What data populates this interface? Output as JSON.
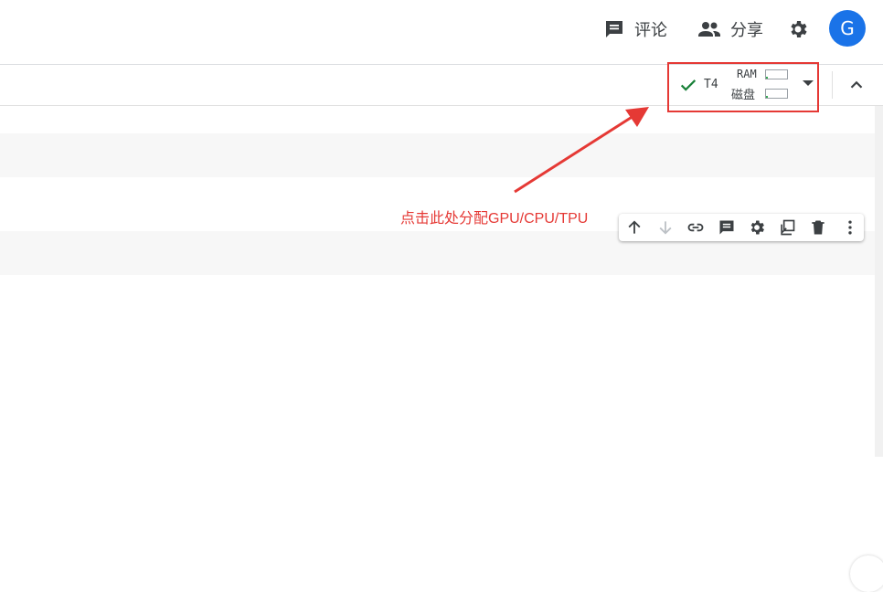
{
  "header": {
    "comment_label": "评论",
    "share_label": "分享",
    "avatar_letter": "G"
  },
  "runtime": {
    "name": "T4",
    "ram_label": "RAM",
    "disk_label": "磁盘",
    "ram_usage_fraction": 0.1,
    "disk_usage_fraction": 0.1,
    "status_color": "#188038"
  },
  "annotation": {
    "text": "点击此处分配GPU/CPU/TPU",
    "color": "#e53935"
  },
  "cell_toolbar": {
    "icons": [
      "arrow-up-icon",
      "arrow-down-icon",
      "link-icon",
      "comment-icon",
      "gear-icon",
      "mirror-cell-icon",
      "delete-icon",
      "more-vert-icon"
    ]
  },
  "colors": {
    "accent": "#1a73e8",
    "icon": "#3c4043"
  }
}
